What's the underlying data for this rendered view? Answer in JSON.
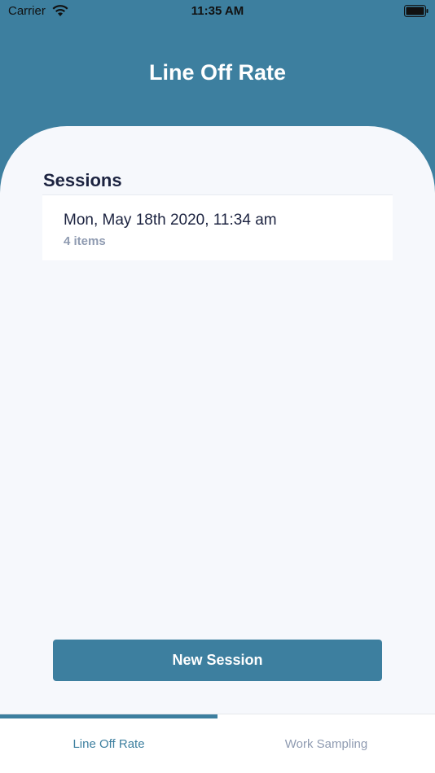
{
  "status_bar": {
    "carrier": "Carrier",
    "time": "11:35 AM"
  },
  "header": {
    "title": "Line Off Rate"
  },
  "sessions": {
    "section_title": "Sessions",
    "items": [
      {
        "title": "Mon, May 18th 2020, 11:34 am",
        "subtitle": "4 items"
      }
    ]
  },
  "actions": {
    "new_session_label": "New Session"
  },
  "tabs": [
    {
      "label": "Line Off Rate",
      "active": true
    },
    {
      "label": "Work Sampling",
      "active": false
    }
  ],
  "colors": {
    "accent": "#3d7f9f",
    "background": "#f6f8fc",
    "text_primary": "#1c2340",
    "text_secondary": "#8f9bb1"
  },
  "icons": [
    "wifi-icon",
    "battery-icon"
  ]
}
